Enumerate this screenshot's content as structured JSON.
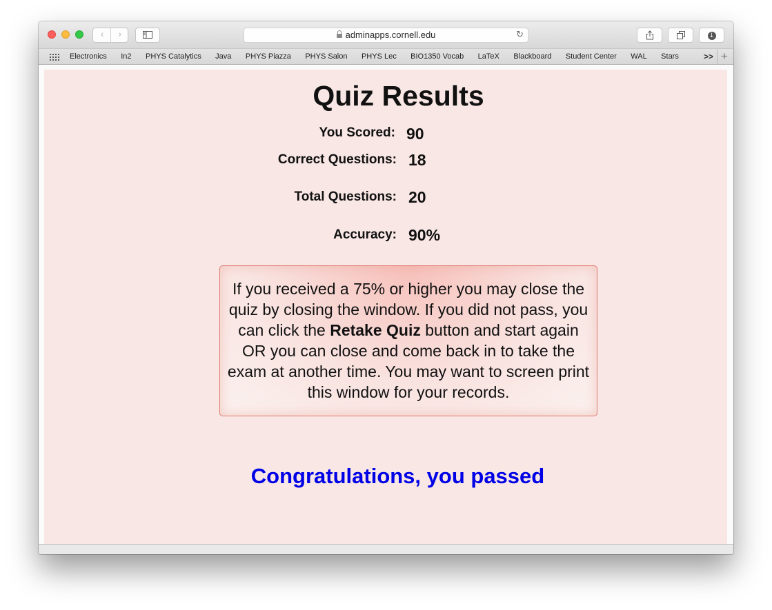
{
  "browser": {
    "url": "adminapps.cornell.edu",
    "bookmarks": [
      "Electronics",
      "In2",
      "PHYS Catalytics",
      "Java",
      "PHYS Piazza",
      "PHYS Salon",
      "PHYS Lec",
      "BIO1350 Vocab",
      "LaTeX",
      "Blackboard",
      "Student Center",
      "WAL",
      "Stars"
    ],
    "bookmarks_more": ">>"
  },
  "quiz": {
    "title": "Quiz Results",
    "score_label": "You Scored:",
    "score_value": "90",
    "correct_label": "Correct Questions:",
    "correct_value": "18",
    "total_label": "Total Questions:",
    "total_value": "20",
    "accuracy_label": "Accuracy:",
    "accuracy_value": "90%",
    "notice_part1": "If you received a 75% or higher you may close the quiz by closing the window.  If you did not pass, you can click the ",
    "notice_bold": "Retake Quiz",
    "notice_part2": " button and start again OR you can close and come back in to take the exam at another time. You may want to screen print this window for your records.",
    "pass_message": "Congratulations, you passed"
  },
  "colors": {
    "page_background": "#f8e7e4",
    "notice_border": "#e07b70",
    "pass_message": "#0000e6"
  }
}
